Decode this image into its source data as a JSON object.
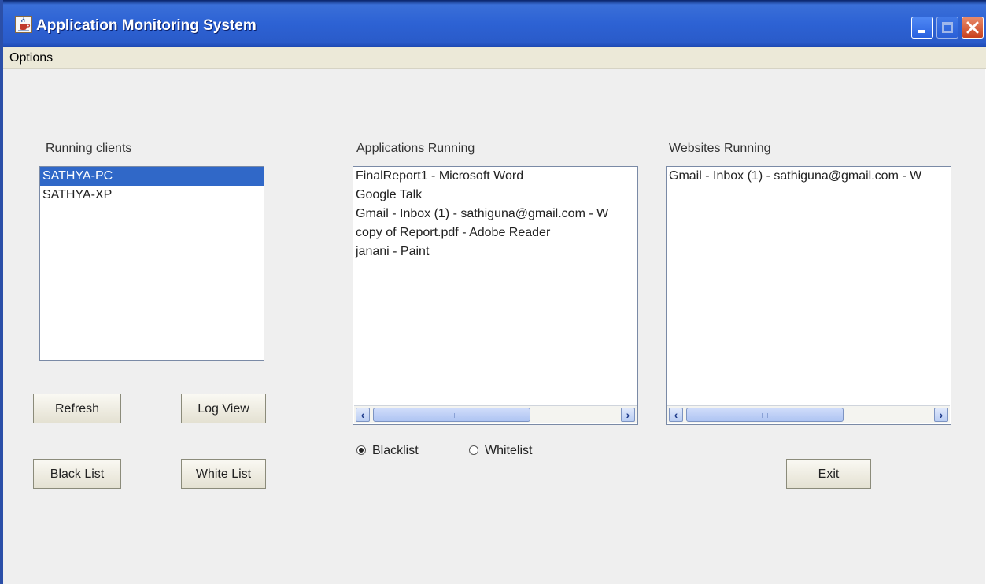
{
  "window": {
    "title": "Application Monitoring System",
    "icon": "java-cup-icon",
    "controls": [
      "minimize-icon",
      "maximize-icon",
      "close-icon"
    ]
  },
  "menu": {
    "items": [
      "Options"
    ]
  },
  "clients": {
    "label": "Running clients",
    "items": [
      "SATHYA-PC",
      "SATHYA-XP"
    ],
    "selected": "SATHYA-PC"
  },
  "applications": {
    "label": "Applications Running",
    "items": [
      "FinalReport1 - Microsoft Word",
      "Google Talk",
      "Gmail - Inbox (1) - sathiguna@gmail.com - W",
      "copy of Report.pdf - Adobe Reader",
      "janani - Paint"
    ]
  },
  "websites": {
    "label": "Websites Running",
    "items": [
      "Gmail - Inbox (1) - sathiguna@gmail.com - W"
    ]
  },
  "buttons": {
    "refresh": "Refresh",
    "log_view": "Log View",
    "black_list": "Black List",
    "white_list": "White List",
    "exit": "Exit"
  },
  "filter_mode": {
    "options": [
      "Blacklist",
      "Whitelist"
    ],
    "selected": "Blacklist"
  },
  "colors": {
    "title_bar": "#2d62d4",
    "selection": "#3068c8",
    "window_bg": "#efefef"
  }
}
